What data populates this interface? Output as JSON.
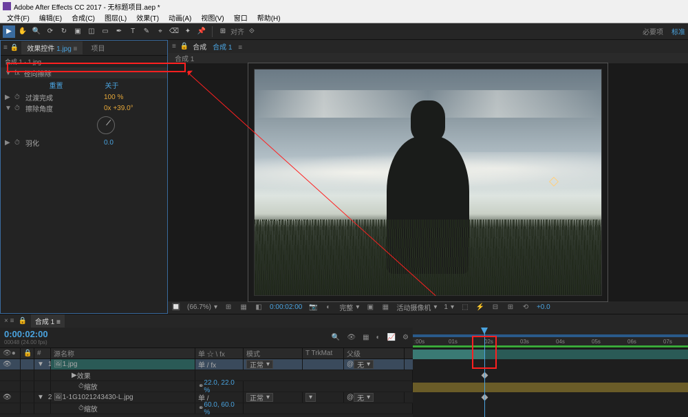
{
  "title": "Adobe After Effects CC 2017 - 无标题项目.aep *",
  "menu": [
    "文件(F)",
    "编辑(E)",
    "合成(C)",
    "图层(L)",
    "效果(T)",
    "动画(A)",
    "视图(V)",
    "窗口",
    "帮助(H)"
  ],
  "toolbar": {
    "align_label": "对齐",
    "workspace_essential": "必要项",
    "workspace_standard": "标准"
  },
  "effects_panel": {
    "tab1_prefix": "效果控件",
    "tab1_link": "1.jpg",
    "tab2": "项目",
    "header": "合成 1 · 1.jpg",
    "effect_name": "径向擦除",
    "divider_reset": "重置",
    "divider_about": "关于",
    "prop1": {
      "name": "过渡完成",
      "value": "100 %"
    },
    "prop2": {
      "name": "擦除角度",
      "value": "0x +39.0°"
    },
    "prop3": {
      "name": "羽化",
      "value": "0.0"
    }
  },
  "viewer": {
    "tab_prefix": "合成",
    "tab_link": "合成 1",
    "subtab": "合成 1",
    "status": {
      "zoom": "(66.7%)",
      "time": "0:00:02:00",
      "quality": "完整",
      "camera": "活动摄像机",
      "views": "1",
      "exposure": "+0.0"
    }
  },
  "timeline": {
    "tab": "合成 1",
    "timecode": "0:00:02:00",
    "timecode_sub": "00048 (24.00 fps)",
    "col_sourcename": "源名称",
    "col_switches": "单 ☆ \\ fx",
    "col_mode": "模式",
    "col_trkmat": "T  TrkMat",
    "col_parent": "父级",
    "layers": [
      {
        "num": "1",
        "name": "1.jpg",
        "sw": "单  /  fx",
        "mode": "正常",
        "parent": "无",
        "color": "teal"
      },
      {
        "num": "2",
        "name": "1-1G1021243430-L.jpg",
        "sw": "单  /",
        "mode": "正常",
        "parent": "无",
        "color": "yellow"
      }
    ],
    "layer1_fx": "效果",
    "layer1_scale": "缩放",
    "layer1_scale_val": "22.0, 22.0 %",
    "layer2_scale": "缩放",
    "layer2_scale_val": "60.0, 60.0 %",
    "ruler": [
      ":00s",
      "01s",
      "02s",
      "03s",
      "04s",
      "05s",
      "06s",
      "07s"
    ]
  }
}
